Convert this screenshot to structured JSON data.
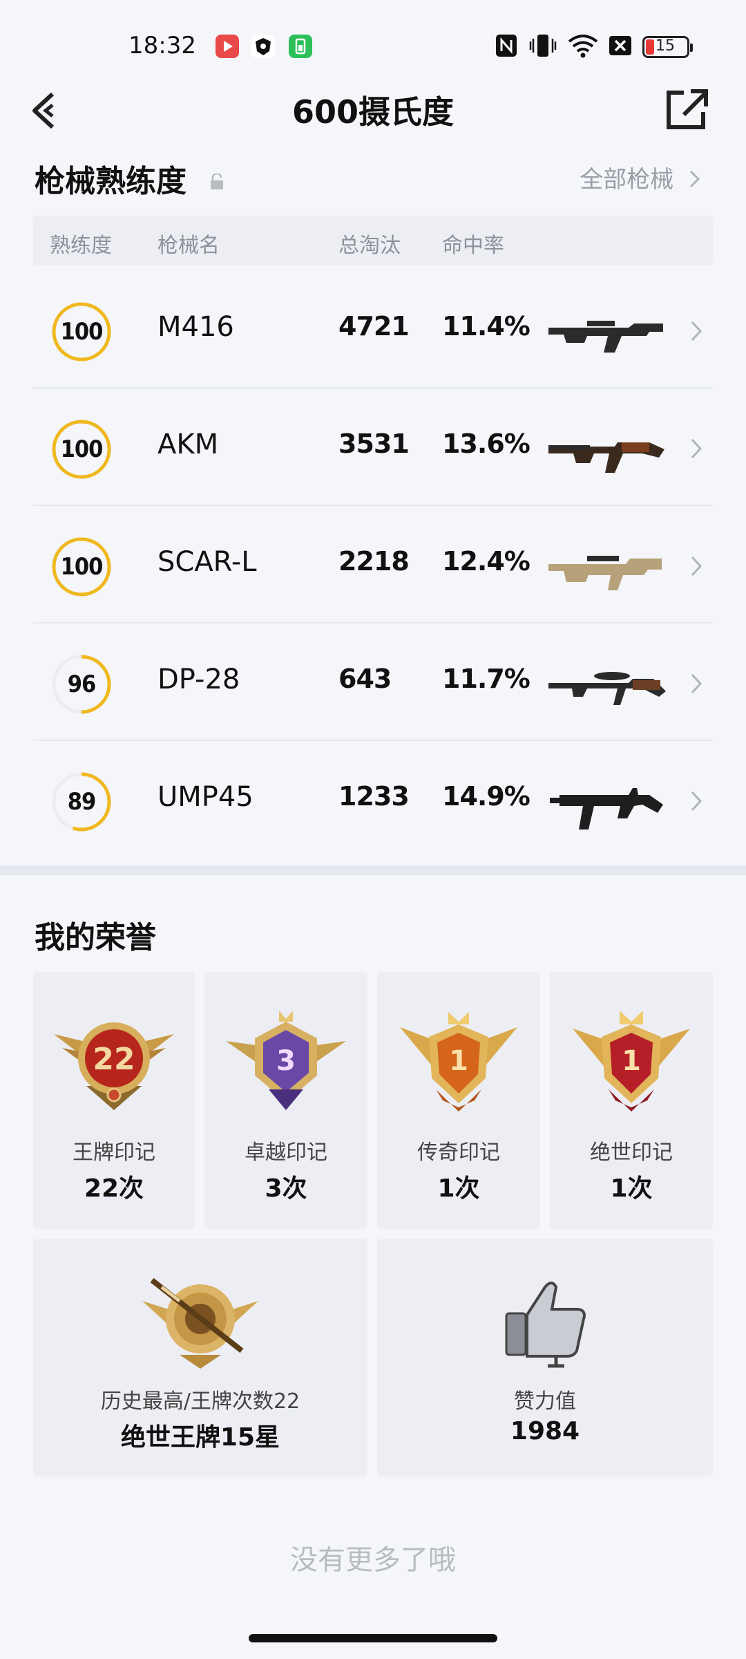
{
  "status_bar": {
    "time": "18:32",
    "battery": "15"
  },
  "header": {
    "title": "600摄氏度"
  },
  "weapons": {
    "section_title": "枪械熟练度",
    "all_link": "全部枪械",
    "columns": [
      "熟练度",
      "枪械名",
      "总淘汰",
      "命中率"
    ],
    "rows": [
      {
        "proficiency": "100",
        "progress": 1.0,
        "name": "M416",
        "kills": "4721",
        "rate": "11.4%"
      },
      {
        "proficiency": "100",
        "progress": 1.0,
        "name": "AKM",
        "kills": "3531",
        "rate": "13.6%"
      },
      {
        "proficiency": "100",
        "progress": 1.0,
        "name": "SCAR-L",
        "kills": "2218",
        "rate": "12.4%"
      },
      {
        "proficiency": "96",
        "progress": 0.5,
        "name": "DP-28",
        "kills": "643",
        "rate": "11.7%"
      },
      {
        "proficiency": "89",
        "progress": 0.55,
        "name": "UMP45",
        "kills": "1233",
        "rate": "14.9%"
      }
    ]
  },
  "honors": {
    "section_title": "我的荣誉",
    "badges": [
      {
        "label": "王牌印记",
        "value": "22次",
        "badge_number": "22"
      },
      {
        "label": "卓越印记",
        "value": "3次",
        "badge_number": "3"
      },
      {
        "label": "传奇印记",
        "value": "1次",
        "badge_number": "1"
      },
      {
        "label": "绝世印记",
        "value": "1次",
        "badge_number": "1"
      }
    ],
    "highest": {
      "label": "历史最高/王牌次数22",
      "value": "绝世王牌15星"
    },
    "likes": {
      "label": "赞力值",
      "value": "1984"
    }
  },
  "footer": {
    "note": "没有更多了哦"
  },
  "colors": {
    "ring": "#f0b81f",
    "ring_track": "#ebedf1",
    "accent_text": "#111111"
  }
}
